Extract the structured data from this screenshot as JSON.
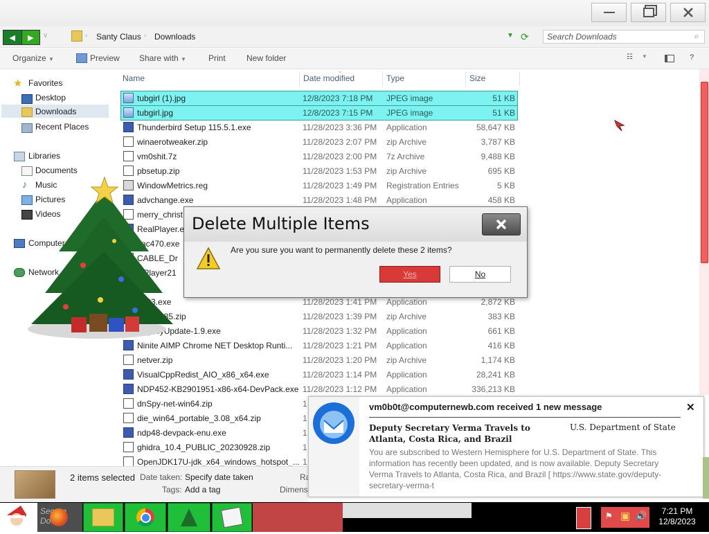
{
  "window": {
    "breadcrumb": [
      "Santy Claus",
      "Downloads"
    ],
    "search_placeholder": "Search Downloads",
    "buttons": {
      "minimize": "—",
      "maximize": "❐",
      "close": "✕"
    }
  },
  "toolbar": {
    "organize": "Organize",
    "preview": "Preview",
    "share_with": "Share with",
    "print": "Print",
    "new_folder": "New folder",
    "help": "?"
  },
  "nav": {
    "favorites": "Favorites",
    "desktop": "Desktop",
    "downloads": "Downloads",
    "recent_places": "Recent Places",
    "libraries": "Libraries",
    "documents": "Documents",
    "music": "Music",
    "pictures": "Pictures",
    "videos": "Videos",
    "computer": "Computer",
    "network": "Network"
  },
  "columns": {
    "name": "Name",
    "date": "Date modified",
    "type": "Type",
    "size": "Size"
  },
  "files": [
    {
      "name": "tubgirl (1).jpg",
      "date": "12/8/2023 7:18 PM",
      "type": "JPEG image",
      "size": "51 KB",
      "selected": true,
      "icon": "image-file-icon"
    },
    {
      "name": "tubgirl.jpg",
      "date": "12/8/2023 7:15 PM",
      "type": "JPEG image",
      "size": "51 KB",
      "selected": true,
      "icon": "image-file-icon"
    },
    {
      "name": "Thunderbird Setup 115.5.1.exe",
      "date": "11/28/2023 3:36 PM",
      "type": "Application",
      "size": "58,647 KB",
      "selected": false,
      "icon": "exe-file-icon"
    },
    {
      "name": "winaerotweaker.zip",
      "date": "11/28/2023 2:07 PM",
      "type": "zip Archive",
      "size": "3,787 KB",
      "selected": false,
      "icon": "zip-file-icon"
    },
    {
      "name": "vm0shit.7z",
      "date": "11/28/2023 2:00 PM",
      "type": "7z Archive",
      "size": "9,488 KB",
      "selected": false,
      "icon": "zip-file-icon"
    },
    {
      "name": "pbsetup.zip",
      "date": "11/28/2023 1:53 PM",
      "type": "zip Archive",
      "size": "695 KB",
      "selected": false,
      "icon": "zip-file-icon"
    },
    {
      "name": "WindowMetrics.reg",
      "date": "11/28/2023 1:49 PM",
      "type": "Registration Entries",
      "size": "5 KB",
      "selected": false,
      "icon": "reg-file-icon"
    },
    {
      "name": "advchange.exe",
      "date": "11/28/2023 1:48 PM",
      "type": "Application",
      "size": "458 KB",
      "selected": false,
      "icon": "exe-file-icon"
    },
    {
      "name": "merry_christ",
      "date": "",
      "type": "",
      "size": "",
      "selected": false,
      "icon": "zip-file-icon"
    },
    {
      "name": "RealPlayer.ex",
      "date": "",
      "type": "",
      "size": "",
      "selected": false,
      "icon": "exe-file-icon"
    },
    {
      "name": "vac470.exe",
      "date": "",
      "type": "",
      "size": "",
      "selected": false,
      "icon": "exe-file-icon"
    },
    {
      "name": "CABLE_Dr",
      "date": "",
      "type": "",
      "size": "",
      "selected": false,
      "icon": "zip-file-icon"
    },
    {
      "name": "olPlayer21",
      "date": "",
      "type": "",
      "size": "",
      "selected": false,
      "icon": "exe-file-icon"
    },
    {
      "name": "rc1.",
      "date": "",
      "type": "",
      "size": "",
      "selected": false,
      "icon": "exe-file-icon"
    },
    {
      "name": "p003.exe",
      "date": "11/28/2023 1:41 PM",
      "type": "Application",
      "size": "2,872 KB",
      "selected": false,
      "icon": "exe-file-icon"
    },
    {
      "name": "mplay385.zip",
      "date": "11/28/2023 1:39 PM",
      "type": "zip Archive",
      "size": "383 KB",
      "selected": false,
      "icon": "zip-file-icon"
    },
    {
      "name": "LegacyUpdate-1.9.exe",
      "date": "11/28/2023 1:32 PM",
      "type": "Application",
      "size": "661 KB",
      "selected": false,
      "icon": "exe-file-icon"
    },
    {
      "name": "Ninite AIMP Chrome NET Desktop Runti...",
      "date": "11/28/2023 1:21 PM",
      "type": "Application",
      "size": "416 KB",
      "selected": false,
      "icon": "exe-file-icon"
    },
    {
      "name": "netver.zip",
      "date": "11/28/2023 1:20 PM",
      "type": "zip Archive",
      "size": "1,174 KB",
      "selected": false,
      "icon": "zip-file-icon"
    },
    {
      "name": "VisualCppRedist_AIO_x86_x64.exe",
      "date": "11/28/2023 1:14 PM",
      "type": "Application",
      "size": "28,241 KB",
      "selected": false,
      "icon": "exe-file-icon"
    },
    {
      "name": "NDP452-KB2901951-x86-x64-DevPack.exe",
      "date": "11/28/2023 1:12 PM",
      "type": "Application",
      "size": "336,213 KB",
      "selected": false,
      "icon": "exe-file-icon"
    },
    {
      "name": "dnSpy-net-win64.zip",
      "date": "1",
      "type": "",
      "size": "",
      "selected": false,
      "icon": "zip-file-icon"
    },
    {
      "name": "die_win64_portable_3.08_x64.zip",
      "date": "1",
      "type": "",
      "size": "",
      "selected": false,
      "icon": "zip-file-icon"
    },
    {
      "name": "ndp48-devpack-enu.exe",
      "date": "1",
      "type": "",
      "size": "",
      "selected": false,
      "icon": "exe-file-icon"
    },
    {
      "name": "ghidra_10.4_PUBLIC_20230928.zip",
      "date": "1",
      "type": "",
      "size": "",
      "selected": false,
      "icon": "zip-file-icon"
    },
    {
      "name": "OpenJDK17U-jdk_x64_windows_hotspot_...",
      "date": "1",
      "type": "",
      "size": "",
      "selected": false,
      "icon": "zip-file-icon"
    }
  ],
  "dialog": {
    "title": "Delete Multiple Items",
    "message": "Are you sure you want to permanently delete these 2 items?",
    "yes": "Yes",
    "no": "No"
  },
  "notification": {
    "header": "vm0b0t@computernewb.com received 1 new message",
    "subject": "Deputy Secretary Verma Travels to Atlanta, Costa Rica, and Brazil",
    "sender": "U.S. Department of State",
    "body": "You are subscribed to Western Hemisphere for U.S. Department of State. This information has recently been updated, and is now available. Deputy Secretary Verma Travels to Atlanta, Costa Rica, and Brazil [ https://www.state.gov/deputy-secretary-verma-t"
  },
  "details": {
    "selection": "2 items selected",
    "date_taken_label": "Date taken:",
    "date_taken_value": "Specify date taken",
    "tags_label": "Tags:",
    "tags_value": "Add a tag",
    "ra_label": "Ra",
    "dimens_label": "Dimens"
  },
  "taskbar": {
    "time": "7:21 PM",
    "date": "12/8/2023",
    "behind_text": "Secure Dow"
  },
  "colors": {
    "selection": "#7cf3f0",
    "taskbar_tile": "#1fbf3a",
    "yes_button": "#d83a3a"
  }
}
